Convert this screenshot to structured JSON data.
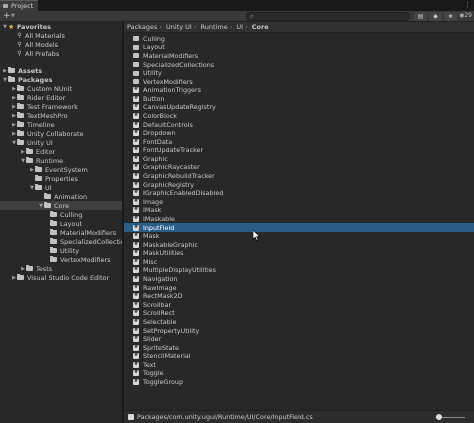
{
  "window": {
    "tab_title": "Project",
    "tab_menu_icon": "kebab-menu-icon"
  },
  "toolbar": {
    "add_label": "+",
    "dropdown_icon": "chevron-down-icon",
    "search_placeholder": "",
    "search_icon": "search-icon",
    "count_label": "29"
  },
  "tree": {
    "favorites_label": "Favorites",
    "favorites_items": [
      "All Materials",
      "All Models",
      "All Prefabs"
    ],
    "assets_label": "Assets",
    "packages_label": "Packages",
    "packages_items": [
      "Custom NUnit",
      "Rider Editor",
      "Test Framework",
      "TextMeshPro",
      "Timeline",
      "Unity Collaborate",
      "Unity UI"
    ],
    "unity_ui_items": [
      "Editor",
      "Runtime"
    ],
    "runtime_items": [
      "EventSystem",
      "Properties",
      "UI"
    ],
    "ui_items": [
      "Animation",
      "Core"
    ],
    "core_items": [
      "Culling",
      "Layout",
      "MaterialModifiers",
      "SpecializedCollectio",
      "Utility",
      "VertexModifiers"
    ],
    "tests_label": "Tests",
    "vscode_label": "Visual Studio Code Editor"
  },
  "breadcrumb": [
    "Packages",
    "Unity UI",
    "Runtime",
    "UI",
    "Core"
  ],
  "files": [
    {
      "name": "Culling",
      "type": "folder"
    },
    {
      "name": "Layout",
      "type": "folder"
    },
    {
      "name": "MaterialModifiers",
      "type": "folder"
    },
    {
      "name": "SpecializedCollections",
      "type": "folder"
    },
    {
      "name": "Utility",
      "type": "folder"
    },
    {
      "name": "VertexModifiers",
      "type": "folder"
    },
    {
      "name": "AnimationTriggers",
      "type": "cs"
    },
    {
      "name": "Button",
      "type": "cs"
    },
    {
      "name": "CanvasUpdateRegistry",
      "type": "cs"
    },
    {
      "name": "ColorBlock",
      "type": "cs"
    },
    {
      "name": "DefaultControls",
      "type": "cs"
    },
    {
      "name": "Dropdown",
      "type": "cs"
    },
    {
      "name": "FontData",
      "type": "cs"
    },
    {
      "name": "FontUpdateTracker",
      "type": "cs"
    },
    {
      "name": "Graphic",
      "type": "cs"
    },
    {
      "name": "GraphicRaycaster",
      "type": "cs"
    },
    {
      "name": "GraphicRebuildTracker",
      "type": "cs"
    },
    {
      "name": "GraphicRegistry",
      "type": "cs"
    },
    {
      "name": "IGraphicEnabledDisabled",
      "type": "cs"
    },
    {
      "name": "Image",
      "type": "cs"
    },
    {
      "name": "IMask",
      "type": "cs"
    },
    {
      "name": "IMaskable",
      "type": "cs"
    },
    {
      "name": "InputField",
      "type": "cs"
    },
    {
      "name": "Mask",
      "type": "cs"
    },
    {
      "name": "MaskableGraphic",
      "type": "cs"
    },
    {
      "name": "MaskUtilities",
      "type": "cs"
    },
    {
      "name": "Misc",
      "type": "cs"
    },
    {
      "name": "MultipleDisplayUtilities",
      "type": "cs"
    },
    {
      "name": "Navigation",
      "type": "cs"
    },
    {
      "name": "RawImage",
      "type": "cs"
    },
    {
      "name": "RectMask2D",
      "type": "cs"
    },
    {
      "name": "Scrollbar",
      "type": "cs"
    },
    {
      "name": "ScrollRect",
      "type": "cs"
    },
    {
      "name": "Selectable",
      "type": "cs"
    },
    {
      "name": "SetPropertyUtility",
      "type": "cs"
    },
    {
      "name": "Slider",
      "type": "cs"
    },
    {
      "name": "SpriteState",
      "type": "cs"
    },
    {
      "name": "StencilMaterial",
      "type": "cs"
    },
    {
      "name": "Text",
      "type": "cs"
    },
    {
      "name": "Toggle",
      "type": "cs"
    },
    {
      "name": "ToggleGroup",
      "type": "cs"
    }
  ],
  "selected_file": "InputField",
  "status": {
    "path": "Packages/com.unity.ugui/Runtime/UI/Core/InputField.cs",
    "zoom_level": 0.05
  },
  "colors": {
    "selection": "#2c5d87",
    "panel": "#282828",
    "star": "#e0b83a"
  }
}
